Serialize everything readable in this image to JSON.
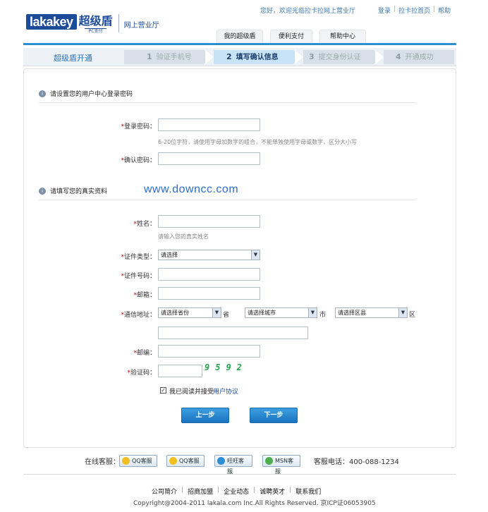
{
  "header": {
    "logo_text": "lakakey",
    "logo_cn": "超级盾",
    "logo_sub": "PC支付",
    "hall": "网上营业厅",
    "welcome": "您好，欢迎光临拉卡拉网上营业厅",
    "links": [
      "登录",
      "拉卡拉首页",
      "帮助"
    ],
    "nav": [
      "我的超级盾",
      "便利支付",
      "帮助中心"
    ],
    "accent": "#2a8fd0"
  },
  "steps": {
    "title": "超级盾开通",
    "items": [
      {
        "num": "1",
        "label": "验证手机号"
      },
      {
        "num": "2",
        "label": "填写确认信息"
      },
      {
        "num": "3",
        "label": "提交身份认证"
      },
      {
        "num": "4",
        "label": "开通成功"
      }
    ]
  },
  "section1": {
    "title": "请设置您的用户中心登录密码",
    "password_label": "登录密码：",
    "password_hint": "6-20位字符，请使用字母加数字的组合，不能单独使用字母或数字，区分大小写",
    "confirm_label": "确认密码："
  },
  "section2": {
    "title": "请填写您的真实资料",
    "watermark": "www.downcc.com",
    "name_label": "姓名：",
    "name_hint": "请输入您的真实姓名",
    "idtype_label": "证件类型：",
    "idtype_value": "请选择",
    "idnum_label": "证件号码：",
    "email_label": "邮箱：",
    "address_label": "通信地址：",
    "province_value": "请选择省份",
    "province_unit": "省",
    "city_value": "请选择城市",
    "city_unit": "市",
    "district_value": "请选择区县",
    "district_unit": "区",
    "zip_label": "邮编：",
    "captcha_label": "验证码：",
    "captcha_code": "9592",
    "agree_text": "我已阅读并接受",
    "agree_link": "用户协议"
  },
  "buttons": {
    "prev": "上一步",
    "next": "下一步"
  },
  "footer": {
    "service_label": "在线客服：",
    "service_buttons": [
      "QQ客服",
      "QQ客服",
      "旺旺客服",
      "MSN客服"
    ],
    "hotline": "客服电话：400-088-1234",
    "links": [
      "公司简介",
      "招商加盟",
      "企业动态",
      "诚聘英才",
      "联系我们"
    ],
    "copyright": "Copyright@2004-2011 lakala.com Inc.All Rights Reserved. 京ICP证06053905"
  }
}
